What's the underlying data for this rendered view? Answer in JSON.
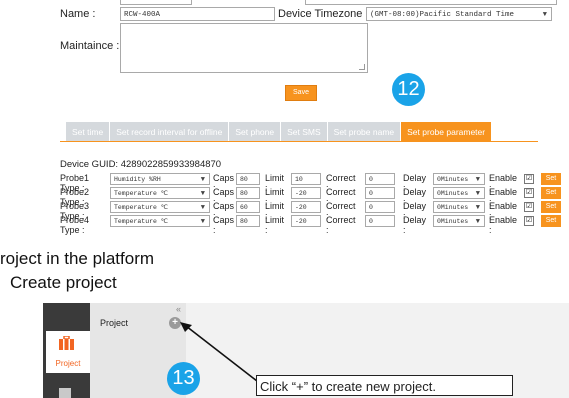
{
  "device_form": {
    "name_label": "Name :",
    "name_value": "RCW-400A",
    "timezone_label": "Device Timezone :",
    "timezone_value": "(GMT-08:00)Pacific Standard Time",
    "maintenance_label": "Maintaince :",
    "maintenance_value": "",
    "save_label": "Save"
  },
  "step_badges": {
    "first": "12",
    "second": "13"
  },
  "tabs": [
    {
      "label": "Set time",
      "active": false
    },
    {
      "label": "Set record interval for offline",
      "active": false
    },
    {
      "label": "Set phone",
      "active": false
    },
    {
      "label": "Set SMS",
      "active": false
    },
    {
      "label": "Set probe name",
      "active": false
    },
    {
      "label": "Set probe parameter",
      "active": true
    }
  ],
  "guid_line": "Device GUID: 4289022859933984870",
  "probe_labels": {
    "caps": "Caps :",
    "limit": "Limit :",
    "correct": "Correct :",
    "delay": "Delay :",
    "enable": "Enable :",
    "set": "Set"
  },
  "probes": [
    {
      "label": "Probe1 Type :",
      "type": "Humidity %RH",
      "caps": "80",
      "limit": "10",
      "correct": "0",
      "delay": "0Minutes",
      "enabled": "☑"
    },
    {
      "label": "Probe2 Type :",
      "type": "Temperature ℃",
      "caps": "80",
      "limit": "-20",
      "correct": "0",
      "delay": "0Minutes",
      "enabled": "☑"
    },
    {
      "label": "Probe3 Type :",
      "type": "Temperature ℃",
      "caps": "60",
      "limit": "-20",
      "correct": "0",
      "delay": "0Minutes",
      "enabled": "☑"
    },
    {
      "label": "Probe4 Type :",
      "type": "Temperature ℃",
      "caps": "80",
      "limit": "-20",
      "correct": "0",
      "delay": "0Minutes",
      "enabled": "☑"
    }
  ],
  "instructions": {
    "heading1": "roject in the platform",
    "heading2": "Create project"
  },
  "platform": {
    "collapse_glyph": "«",
    "panel_title": "Project",
    "plus_label": "+",
    "sidebar_tab_label": "Project",
    "callout": "Click “+” to create new project."
  },
  "colors": {
    "accent_orange": "#f7931e",
    "badge_blue": "#1aa3e8",
    "sidebar_dark": "#3a3a3a",
    "tab_grey": "#d5d9dd"
  }
}
